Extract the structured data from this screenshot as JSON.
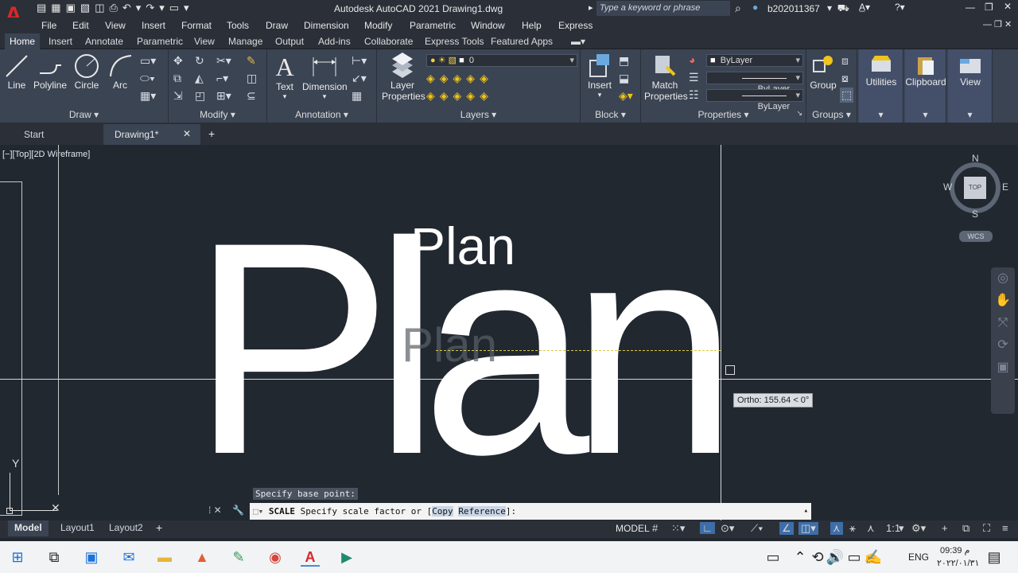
{
  "app": {
    "title": "Autodesk AutoCAD 2021   Drawing1.dwg",
    "search_placeholder": "Type a keyword or phrase",
    "user": "b202011367"
  },
  "menus": [
    "File",
    "Edit",
    "View",
    "Insert",
    "Format",
    "Tools",
    "Draw",
    "Dimension",
    "Modify",
    "Parametric",
    "Window",
    "Help",
    "Express"
  ],
  "ribbon_tabs": [
    "Home",
    "Insert",
    "Annotate",
    "Parametric",
    "View",
    "Manage",
    "Output",
    "Add-ins",
    "Collaborate",
    "Express Tools",
    "Featured Apps"
  ],
  "ribbon": {
    "draw": {
      "title": "Draw",
      "line": "Line",
      "polyline": "Polyline",
      "circle": "Circle",
      "arc": "Arc"
    },
    "modify": {
      "title": "Modify"
    },
    "annotation": {
      "title": "Annotation",
      "text": "Text",
      "dimension": "Dimension"
    },
    "layers": {
      "title": "Layers",
      "layer_properties_1": "Layer",
      "layer_properties_2": "Properties",
      "current_layer": "0"
    },
    "block": {
      "title": "Block",
      "insert": "Insert"
    },
    "properties": {
      "title": "Properties",
      "match_1": "Match",
      "match_2": "Properties",
      "color": "ByLayer",
      "linetype": "ByLayer",
      "lineweight": "ByLayer"
    },
    "groups": {
      "title": "Groups",
      "group": "Group"
    },
    "utilities": "Utilities",
    "clipboard": "Clipboard",
    "view": "View"
  },
  "doc_tabs": {
    "start": "Start",
    "drawing": "Drawing1*"
  },
  "viewport": {
    "label": "[−][Top][2D Wireframe]",
    "text_large": "Plan",
    "text_small": "Plan",
    "text_ghost": "Plan",
    "ortho_tooltip": "Ortho: 155.64 < 0°",
    "compass": {
      "n": "N",
      "s": "S",
      "e": "E",
      "w": "W",
      "top": "TOP",
      "wcs": "WCS"
    },
    "ucs_y": "Y"
  },
  "command": {
    "history": "Specify base point:",
    "prompt_cmd": "SCALE",
    "prompt_text": " Specify scale factor or [",
    "opt_copy": "Copy",
    "opt_reference": "Reference",
    "prompt_end": "]:"
  },
  "layouts": [
    "Model",
    "Layout1",
    "Layout2"
  ],
  "status": {
    "model": "MODEL",
    "scale": "1:1"
  },
  "taskbar": {
    "lang": "ENG",
    "time": "09:39 م",
    "date": "٢٠٢٢/٠١/٣١"
  }
}
